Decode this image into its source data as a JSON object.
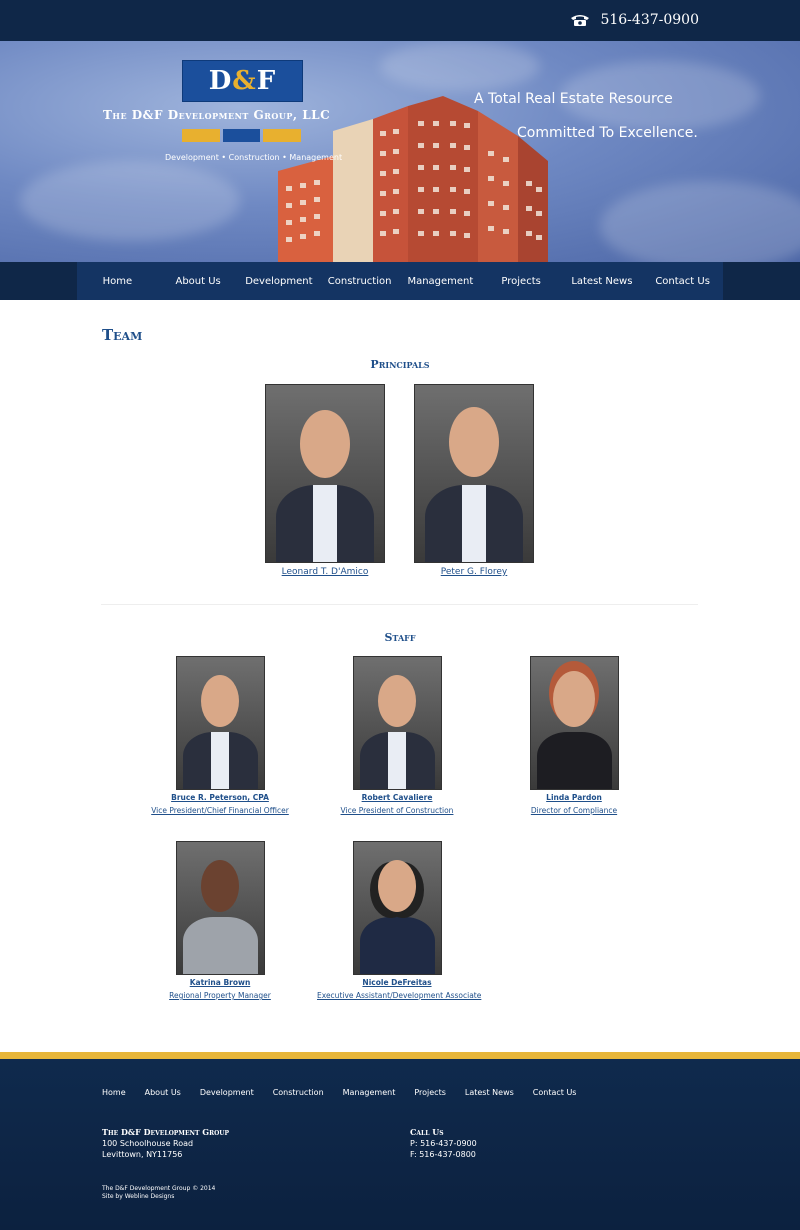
{
  "header": {
    "phone": "516-437-0900"
  },
  "hero": {
    "logo_text_d": "D",
    "logo_text_amp": "&",
    "logo_text_f": "F",
    "company_name": "The D&F Development Group, LLC",
    "tagline_small": "Development • Construction • Management",
    "slogan_line1": "A Total Real Estate Resource",
    "slogan_line2": "Committed To Excellence.",
    "colors": {
      "blue": "#1b4f9c",
      "gold": "#e8b02f"
    }
  },
  "nav": {
    "items": [
      "Home",
      "About Us",
      "Development",
      "Construction",
      "Management",
      "Projects",
      "Latest News",
      "Contact Us"
    ]
  },
  "page": {
    "title": "Team",
    "principals_heading": "Principals",
    "staff_heading": "Staff"
  },
  "principals": [
    {
      "name": "Leonard T. D'Amico"
    },
    {
      "name": "Peter G. Florey"
    }
  ],
  "staff": [
    {
      "name": "Bruce R. Peterson, CPA",
      "title": "Vice President/Chief Financial Officer"
    },
    {
      "name": "Robert Cavaliere",
      "title": "Vice President of Construction"
    },
    {
      "name": "Linda Pardon",
      "title": "Director of Compliance"
    },
    {
      "name": "Katrina Brown",
      "title": "Regional Property Manager"
    },
    {
      "name": "Nicole DeFreitas",
      "title": "Executive Assistant/Development Associate"
    }
  ],
  "footer": {
    "nav": [
      "Home",
      "About Us",
      "Development",
      "Construction",
      "Management",
      "Projects",
      "Latest News",
      "Contact Us"
    ],
    "company_heading": "The D&F Development Group",
    "address1": "100 Schoolhouse Road",
    "address2": "Levittown, NY11756",
    "call_heading": "Call Us",
    "phone": "P: 516-437-0900",
    "fax": "F: 516-437-0800",
    "copyright": "The D&F Development Group © 2014",
    "credit": "Site by Webline Designs"
  }
}
